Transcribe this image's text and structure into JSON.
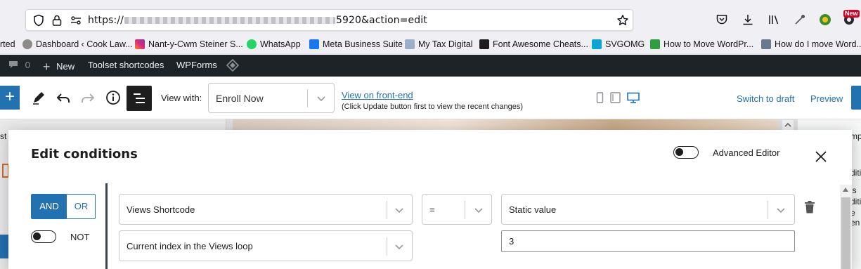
{
  "browser": {
    "url_prefix": "https://",
    "url_suffix": "5920&action=edit",
    "icons": [
      "shield-icon",
      "lock-icon",
      "page-settings-icon",
      "bookmark-star-icon",
      "pocket-icon",
      "download-icon",
      "library-icon",
      "extension-icon",
      "account-icon",
      "whats-new-icon"
    ],
    "new_badge": "New"
  },
  "bookmarks": [
    {
      "label": "rted"
    },
    {
      "label": "Dashboard ‹ Cook Law..."
    },
    {
      "label": "Nant-y-Cwm Steiner S..."
    },
    {
      "label": "WhatsApp"
    },
    {
      "label": "Meta Business Suite"
    },
    {
      "label": "My Tax Digital"
    },
    {
      "label": "Font Awesome Cheats..."
    },
    {
      "label": "SVGOMG"
    },
    {
      "label": "How to Move WordPr..."
    },
    {
      "label": "How do I move Word..."
    }
  ],
  "wp_admin_bar": {
    "comments_count": "0",
    "new_label": "New",
    "toolset_label": "Toolset shortcodes",
    "wpforms_label": "WPForms"
  },
  "editor_toolbar": {
    "add_label": "+",
    "view_with_label": "View with:",
    "view_with_value": "Enroll Now",
    "front_end_link": "View on front-end",
    "front_end_note": "(Click Update button first to view the recent changes)",
    "switch_draft": "Switch to draft",
    "preview": "Preview"
  },
  "background": {
    "left_text": "st",
    "right_texts": [
      "mp",
      "diti",
      "is",
      "ditio",
      "e",
      "en"
    ]
  },
  "modal": {
    "title": "Edit conditions",
    "advanced_editor_label": "Advanced Editor",
    "advanced_editor_on": false,
    "and_label": "AND",
    "or_label": "OR",
    "not_label": "NOT",
    "not_on": false,
    "condition": {
      "left_select": "Views Shortcode",
      "left_sub_select": "Current index in the Views loop",
      "operator": "=",
      "right_select": "Static value",
      "right_value": "3"
    }
  },
  "colors": {
    "wp_blue": "#2271b1",
    "admin_bar": "#1d2327",
    "browser_chrome": "#f0f0f4"
  }
}
